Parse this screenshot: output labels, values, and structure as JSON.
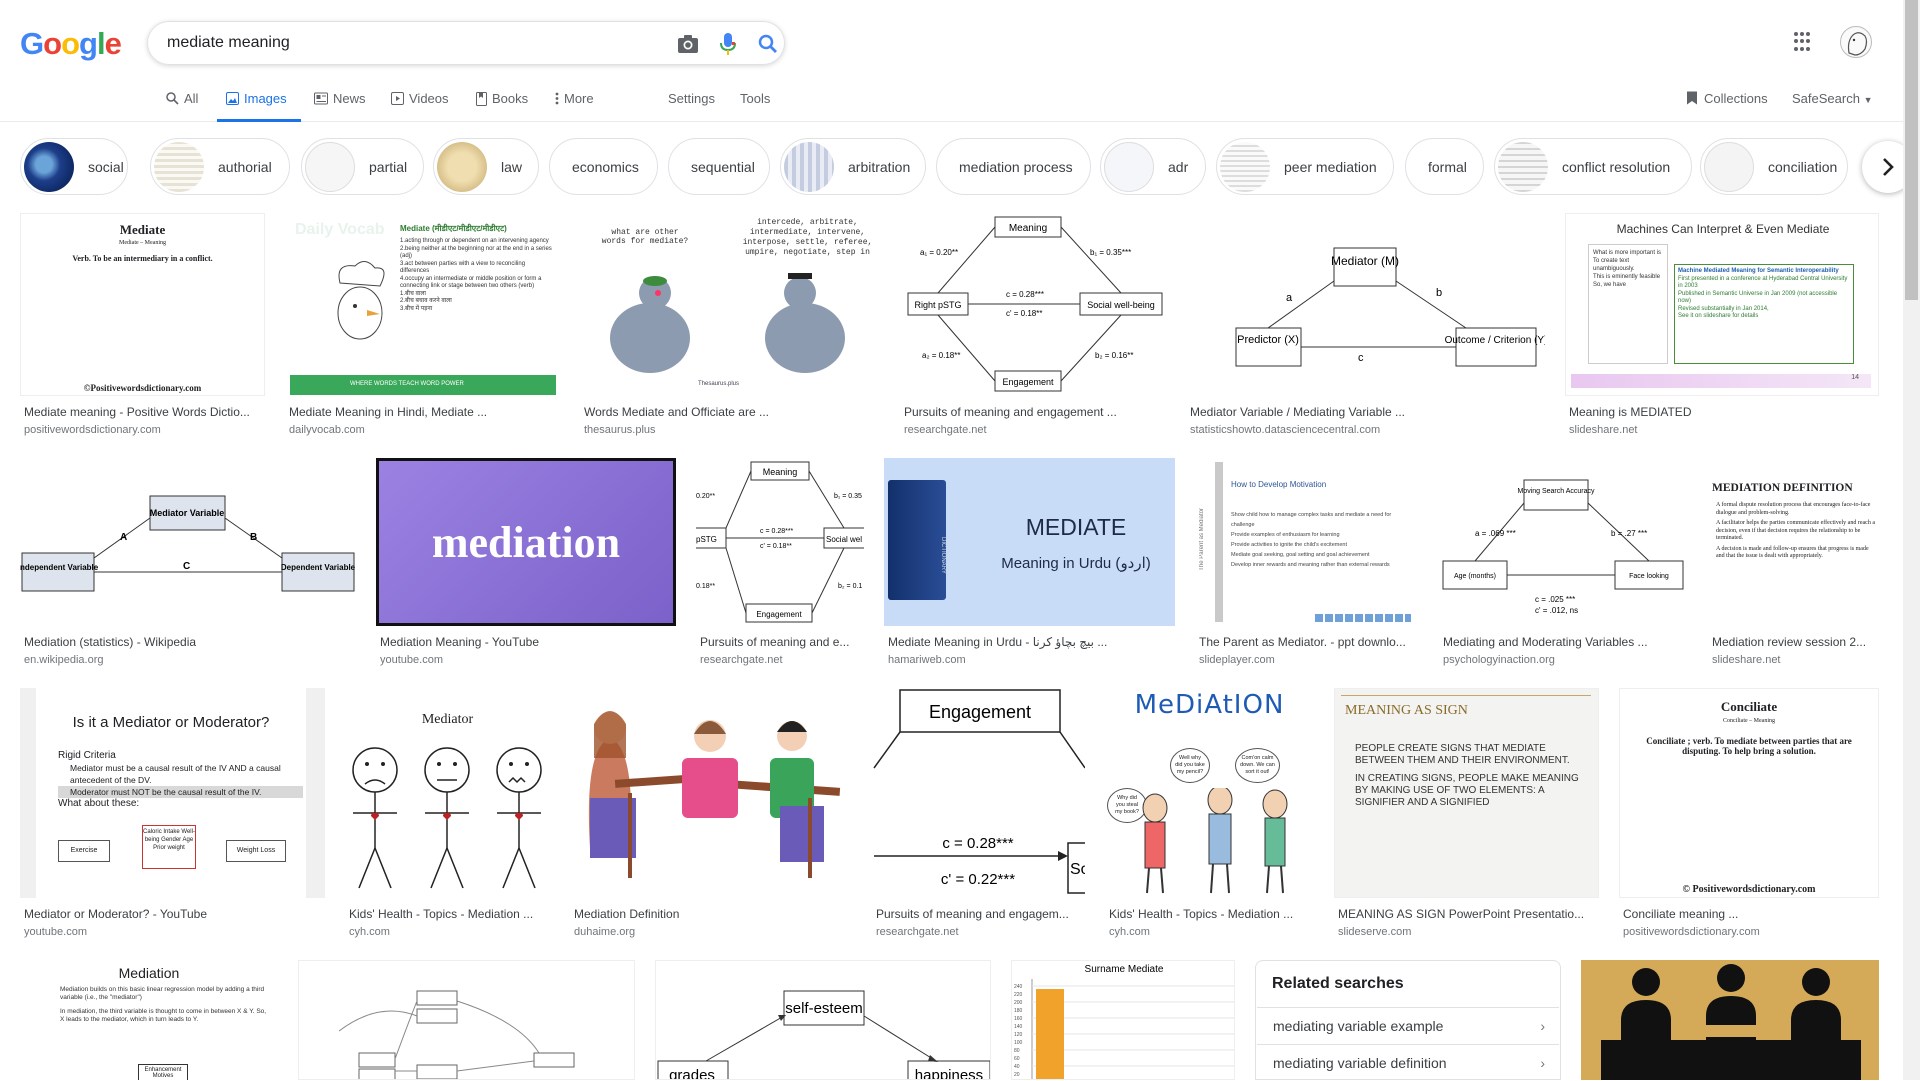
{
  "logo": {
    "letters": [
      "G",
      "o",
      "o",
      "g",
      "l",
      "e"
    ],
    "colors": [
      "#4285F4",
      "#EA4335",
      "#FBBC05",
      "#4285F4",
      "#34A853",
      "#EA4335"
    ]
  },
  "search": {
    "query": "mediate meaning"
  },
  "tabs": [
    "All",
    "Images",
    "News",
    "Videos",
    "Books",
    "More",
    "Settings",
    "Tools"
  ],
  "right_tools": {
    "collections": "Collections",
    "safesearch": "SafeSearch"
  },
  "chips": [
    "social",
    "authorial",
    "partial",
    "law",
    "economics",
    "sequential",
    "arbitration",
    "mediation process",
    "adr",
    "peer mediation",
    "formal",
    "conflict resolution",
    "conciliation"
  ],
  "results": [
    {
      "title": "Mediate meaning - Positive Words Dictio...",
      "source": "positivewordsdictionary.com",
      "img": {
        "heading": "Mediate",
        "sub": "Mediate – Meaning",
        "text": "Verb. To be an intermediary in a conflict.",
        "footer": "©Positivewordsdictionary.com"
      }
    },
    {
      "title": "Mediate Meaning in Hindi, Mediate ...",
      "source": "dailyvocab.com",
      "img": {
        "brand": "Daily Vocab",
        "heading": "Mediate (मीडीएट/मीडीएट/मीडीएट)",
        "lines": [
          "1.acting through or dependent on an intervening agency",
          "2.being neither at the beginning nor at the end in a series (adj)",
          "3.act between parties with a view to reconciling differences",
          "4.occupy an intermediate or middle position or form a connecting link or stage between two others (verb)",
          "1.बीच वाला",
          "2.बीच बचाव करने वाला",
          "3.बीच में पड़ना"
        ],
        "footer": "WHERE WORDS TEACH WORD POWER"
      }
    },
    {
      "title": "Words Mediate and Officiate are ...",
      "source": "thesaurus.plus",
      "img": {
        "q": "what are other words for mediate?",
        "a": "intercede, arbitrate, intermediate, intervene, interpose, settle, referee, umpire, negotiate, step in",
        "brand": "Thesaurus.plus"
      }
    },
    {
      "title": "Pursuits of meaning and engagement ...",
      "source": "researchgate.net",
      "img": {
        "nodes": [
          "Meaning",
          "Right pSTG",
          "Social well-being",
          "Engagement"
        ],
        "labels": [
          "a₁ = 0.20**",
          "b₁ = 0.35***",
          "c = 0.28***",
          "c' = 0.18**",
          "a₂ = 0.18**",
          "b₂ = 0.16**"
        ]
      }
    },
    {
      "title": "Mediator Variable / Mediating Variable ...",
      "source": "statisticshowto.datasciencecentral.com",
      "img": {
        "nodes": [
          "Mediator (M)",
          "Predictor (X)",
          "Outcome / Criterion (Y)"
        ],
        "labels": [
          "a",
          "b",
          "c"
        ]
      }
    },
    {
      "title": "Meaning is MEDIATED",
      "source": "slideshare.net",
      "img": {
        "heading": "Machines Can Interpret & Even Mediate",
        "left": [
          "What is more important is",
          "To create text unambiguously.",
          "This is eminently feasible",
          "So, we have"
        ],
        "right": [
          "Machine Mediated Meaning for Semantic Interoperability",
          "First presented in a conference at Hyderabad Central University in 2003",
          "Published in Semantic Universe in Jan 2009 (not accessible now)",
          "Revised substantially in Jan 2014,",
          "See it on slideshare for details"
        ],
        "page": "14"
      }
    },
    {
      "title": "Mediation (statistics) - Wikipedia",
      "source": "en.wikipedia.org",
      "img": {
        "nodes": [
          "Mediator Variable",
          "Independent Variable",
          "Dependent Variable"
        ],
        "labels": [
          "A",
          "B",
          "C"
        ]
      }
    },
    {
      "title": "Mediation Meaning - YouTube",
      "source": "youtube.com",
      "img": {
        "word": "mediation"
      }
    },
    {
      "title": "Pursuits of meaning and e...",
      "source": "researchgate.net",
      "img": {
        "nodes": [
          "Meaning",
          "pSTG",
          "Social wel",
          "Engagement"
        ],
        "labels": [
          "0.20**",
          "b₁ = 0.35",
          "c = 0.28***",
          "c' = 0.18**",
          "0.18**",
          "b₂ = 0.1"
        ]
      }
    },
    {
      "title": "Mediate Meaning in Urdu - بیچ بچاؤ کرنا ...",
      "source": "hamariweb.com",
      "img": {
        "word": "MEDIATE",
        "sub": "Meaning in Urdu (اردو)",
        "book": "DICTIONARY"
      }
    },
    {
      "title": "The Parent as Mediator. - ppt downlo...",
      "source": "slideplayer.com",
      "img": {
        "heading": "How to Develop Motivation",
        "side": "The Parent as Mediator",
        "lines": [
          "Show child how to manage complex tasks and mediate a need for challenge",
          "Provide examples of enthusiasm for learning",
          "Provide activities to ignite the child's excitement",
          "Mediate goal seeking, goal setting and goal achievement",
          "Develop inner rewards and meaning rather than external rewards"
        ]
      }
    },
    {
      "title": "Mediating and Moderating Variables ...",
      "source": "psychologyinaction.org",
      "img": {
        "nodes": [
          "Moving Search Accuracy",
          "Age (months)",
          "Face looking"
        ],
        "labels": [
          "a = .069 ***",
          "b = .27 ***",
          "c = .025 ***",
          "c' = .012, ns"
        ]
      }
    },
    {
      "title": "Mediation review session 2...",
      "source": "slideshare.net",
      "img": {
        "heading": "MEDIATION DEFINITION",
        "lines": [
          "A formal dispute resolution process that encourages face-to-face dialogue and problem-solving.",
          "A facilitator helps the parties communicate effectively and reach a decision, even if that decision requires the relationship to be terminated.",
          "A decision is made and follow-up ensures that progress is made and that the issue is dealt with appropriately."
        ]
      }
    },
    {
      "title": "Mediator or Moderator? - YouTube",
      "source": "youtube.com",
      "img": {
        "heading": "Is it a Mediator or Moderator?",
        "lines": [
          "Rigid Criteria",
          "Mediator must be a causal result of the IV AND a causal antecedent of the DV.",
          "Moderator must NOT be the causal result of the IV.",
          "What about these:"
        ],
        "boxes": [
          "Exercise",
          "Caloric Intake Well-being Gender Age Prior weight",
          "Weight Loss"
        ]
      }
    },
    {
      "title": "Kids' Health - Topics - Mediation ...",
      "source": "cyh.com",
      "img": {
        "heading": "Mediator"
      }
    },
    {
      "title": "Mediation Definition",
      "source": "duhaime.org",
      "img": {}
    },
    {
      "title": "Pursuits of meaning and engagem...",
      "source": "researchgate.net",
      "img": {
        "node": "Engagement",
        "labels": [
          "c = 0.28***",
          "c' = 0.22***"
        ],
        "edge": "So"
      }
    },
    {
      "title": "Kids' Health - Topics - Mediation ...",
      "source": "cyh.com",
      "img": {
        "heading": "MeDiAtION",
        "bubbles": [
          "Why did you steal my book?",
          "Well why did you take my pencil?",
          "Com'on calm down. We can sort it out!"
        ]
      }
    },
    {
      "title": "MEANING AS SIGN PowerPoint Presentatio...",
      "source": "slideserve.com",
      "img": {
        "heading": "MEANING AS SIGN",
        "lines": [
          "PEOPLE CREATE SIGNS THAT MEDIATE BETWEEN THEM AND THEIR ENVIRONMENT.",
          "IN CREATING SIGNS, PEOPLE MAKE MEANING BY MAKING USE OF TWO ELEMENTS: A SIGNIFIER AND A SIGNIFIED"
        ]
      }
    },
    {
      "title": "Conciliate meaning ...",
      "source": "positivewordsdictionary.com",
      "img": {
        "heading": "Conciliate",
        "sub": "Conciliate – Meaning",
        "text": "Conciliate ; verb. To mediate between parties that are disputing. To help bring a solution.",
        "footer": "© Positivewordsdictionary.com"
      }
    }
  ],
  "row4": {
    "mediation_slide": {
      "heading": "Mediation",
      "lines": [
        "Mediation builds on this basic linear regression model by adding a third variable (i.e., the \"mediator\")",
        "In mediation, the third variable is thought to come in between X & Y. So, X leads to the mediator, which in turn leads to Y."
      ],
      "box": "Enhancement Motives"
    },
    "selfesteem": {
      "nodes": [
        "self-esteem",
        "grades",
        "happiness"
      ]
    },
    "surname": {
      "title": "Surname Mediate",
      "ticks": [
        "240",
        "220",
        "200",
        "180",
        "160",
        "140",
        "120",
        "100",
        "80",
        "60",
        "40",
        "20"
      ]
    }
  },
  "related": {
    "heading": "Related searches",
    "items": [
      "mediating variable example",
      "mediating variable definition"
    ]
  }
}
